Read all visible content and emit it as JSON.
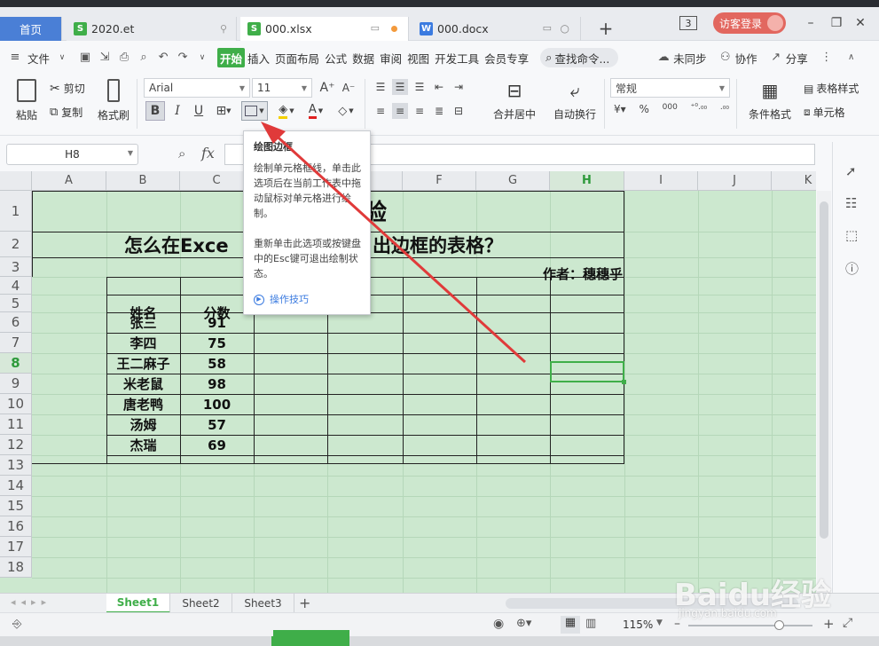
{
  "tabs": {
    "home": "首页",
    "t1": "2020.et",
    "t2": "000.xlsx",
    "t3": "000.docx",
    "add": "+"
  },
  "window": {
    "badge": "3",
    "login": "访客登录"
  },
  "menu": {
    "file": "文件",
    "items": [
      "开始",
      "插入",
      "页面布局",
      "公式",
      "数据",
      "审阅",
      "视图",
      "开发工具",
      "会员专享"
    ],
    "search": "查找命令...",
    "unsync": "未同步",
    "collab": "协作",
    "share": "分享"
  },
  "ribbon": {
    "paste": "粘贴",
    "cut": "剪切",
    "copy": "复制",
    "format_painter": "格式刷",
    "font": "Arial",
    "size": "11",
    "merge": "合并居中",
    "wrap": "自动换行",
    "numfmt": "常规",
    "cond_fmt": "条件格式",
    "table_style": "表格样式",
    "cell_fmt": "单元格"
  },
  "formula": {
    "namebox": "H8",
    "fx": "fx"
  },
  "columns": [
    "A",
    "B",
    "C",
    "D",
    "E",
    "F",
    "G",
    "H",
    "I",
    "J",
    "K"
  ],
  "rows": [
    "1",
    "2",
    "3",
    "4",
    "5",
    "6",
    "7",
    "8",
    "9",
    "10",
    "11",
    "12",
    "13",
    "14",
    "15",
    "16",
    "17",
    "18"
  ],
  "content": {
    "title_fragment": "验",
    "subtitle_a": "怎么在Exce",
    "subtitle_b": "出边框的表格？",
    "author": "作者：穗穗乎",
    "header_name": "姓名",
    "header_score": "分数",
    "names": [
      "张三",
      "李四",
      "王二麻子",
      "米老鼠",
      "唐老鸭",
      "汤姆",
      "杰瑞"
    ],
    "scores": [
      "91",
      "75",
      "58",
      "98",
      "100",
      "57",
      "69"
    ]
  },
  "tooltip": {
    "title": "绘图边框",
    "body1": "绘制单元格框线，单击此选项后在当前工作表中拖动鼠标对单元格进行绘制。",
    "body2": "重新单击此选项或按键盘中的Esc键可退出绘制状态。",
    "link": "操作技巧"
  },
  "sheets": [
    "Sheet1",
    "Sheet2",
    "Sheet3"
  ],
  "status": {
    "zoom": "115%",
    "zoom_level_percent": 115
  },
  "colors": {
    "accent": "#3fae49",
    "sheet_bg": "#cce8cf",
    "home_tab": "#4a7fd6",
    "arrow": "#e03a3a",
    "login": "#e2675f"
  },
  "watermark": {
    "brand": "Baidu经验",
    "url": "jingyan.baidu.com"
  }
}
